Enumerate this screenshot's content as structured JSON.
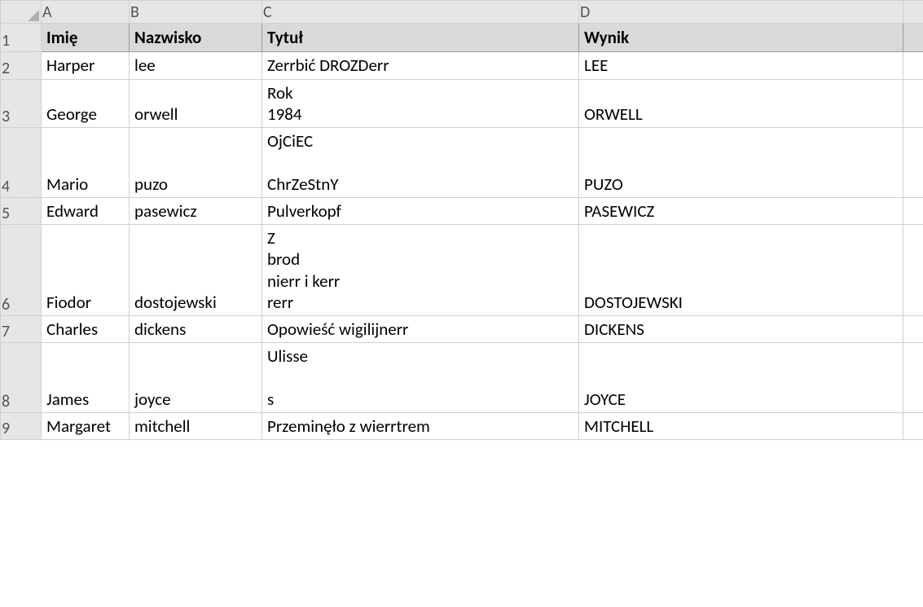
{
  "columns": [
    "A",
    "B",
    "C",
    "D"
  ],
  "header_row_num": "1",
  "headers": {
    "A": "Imię",
    "B": "Nazwisko",
    "C": "Tytuł",
    "D": "Wynik"
  },
  "rows": [
    {
      "num": "2",
      "A": "Harper",
      "B": "lee",
      "C": "Zerrbić DROZDerr",
      "D": "LEE"
    },
    {
      "num": "3",
      "A": "George",
      "B": "orwell",
      "C": "Rok\n1984",
      "D": "ORWELL"
    },
    {
      "num": "4",
      "A": "Mario",
      "B": "puzo",
      "C": "OjCiEC\n\n ChrZeStnY",
      "D": "PUZO"
    },
    {
      "num": "5",
      "A": "Edward",
      "B": "pasewicz",
      "C": "Pulverkopf",
      "D": "PASEWICZ"
    },
    {
      "num": "6",
      "A": "Fiodor",
      "B": "dostojewski",
      "C": "Z\nbrod\nnierr i kerr\nrerr",
      "D": "DOSTOJEWSKI"
    },
    {
      "num": "7",
      "A": "Charles",
      "B": "dickens",
      "C": "Opowieść    wigilijnerr",
      "D": "DICKENS"
    },
    {
      "num": "8",
      "A": "James",
      "B": "joyce",
      "C": "Ulisse\n\ns",
      "D": "JOYCE"
    },
    {
      "num": "9",
      "A": "Margaret",
      "B": "mitchell",
      "C": "Przeminęło     z      wierrtrem",
      "D": "MITCHELL"
    }
  ]
}
